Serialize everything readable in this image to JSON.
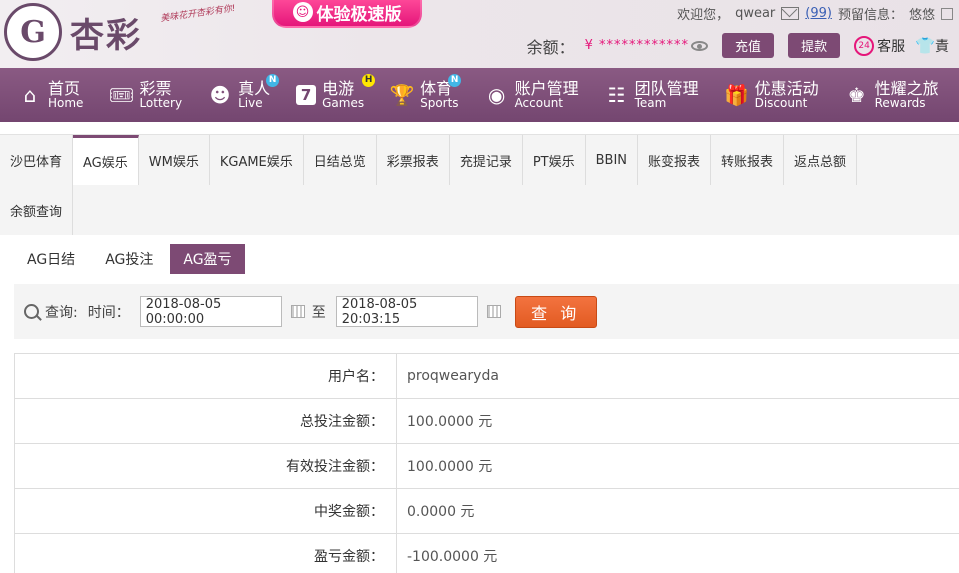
{
  "header": {
    "logo_glyph": "G",
    "brand": "杏彩",
    "slogan": "美味花开杏彩有你!",
    "promo": "体验极速版",
    "welcome": "欢迎您，",
    "username": "qwear",
    "msg_count": "(99)",
    "notice_label": "预留信息：",
    "notice_value": "悠悠",
    "balance_label": "余额：",
    "balance_value": "¥ ************",
    "deposit": "充值",
    "withdraw": "提款",
    "service_badge": "24",
    "service": "客服",
    "vip": "責"
  },
  "nav": [
    {
      "zh": "首页",
      "en": "Home",
      "icon": "⌂"
    },
    {
      "zh": "彩票",
      "en": "Lottery",
      "icon": "🎟",
      "badge": ""
    },
    {
      "zh": "真人",
      "en": "Live",
      "icon": "☻",
      "badge": "N"
    },
    {
      "zh": "电游",
      "en": "Games",
      "icon": "7",
      "badge": "H"
    },
    {
      "zh": "体育",
      "en": "Sports",
      "icon": "🏆",
      "badge": "N"
    },
    {
      "zh": "账户管理",
      "en": "Account",
      "icon": "◉"
    },
    {
      "zh": "团队管理",
      "en": "Team",
      "icon": "☷"
    },
    {
      "zh": "优惠活动",
      "en": "Discount",
      "icon": "🎁"
    },
    {
      "zh": "性耀之旅",
      "en": "Rewards",
      "icon": "♚"
    }
  ],
  "tabs_row1": [
    "沙巴体育",
    "AG娱乐",
    "WM娱乐",
    "KGAME娱乐",
    "日结总览",
    "彩票报表",
    "充提记录",
    "PT娱乐",
    "BBIN",
    "账变报表",
    "转账报表",
    "返点总额"
  ],
  "tabs_row2": [
    "余额查询"
  ],
  "subtabs": [
    "AG日结",
    "AG投注",
    "AG盈亏"
  ],
  "query": {
    "label": "查询:",
    "time_label": "时间：",
    "start": "2018-08-05 00:00:00",
    "to": "至",
    "end": "2018-08-05 20:03:15",
    "button": "查 询"
  },
  "results": [
    {
      "label": "用户名：",
      "value": "proqwearyda"
    },
    {
      "label": "总投注金额：",
      "value": "100.0000 元"
    },
    {
      "label": "有效投注金额：",
      "value": "100.0000 元"
    },
    {
      "label": "中奖金额：",
      "value": "0.0000 元"
    },
    {
      "label": "盈亏金额：",
      "value": "-100.0000 元"
    }
  ]
}
